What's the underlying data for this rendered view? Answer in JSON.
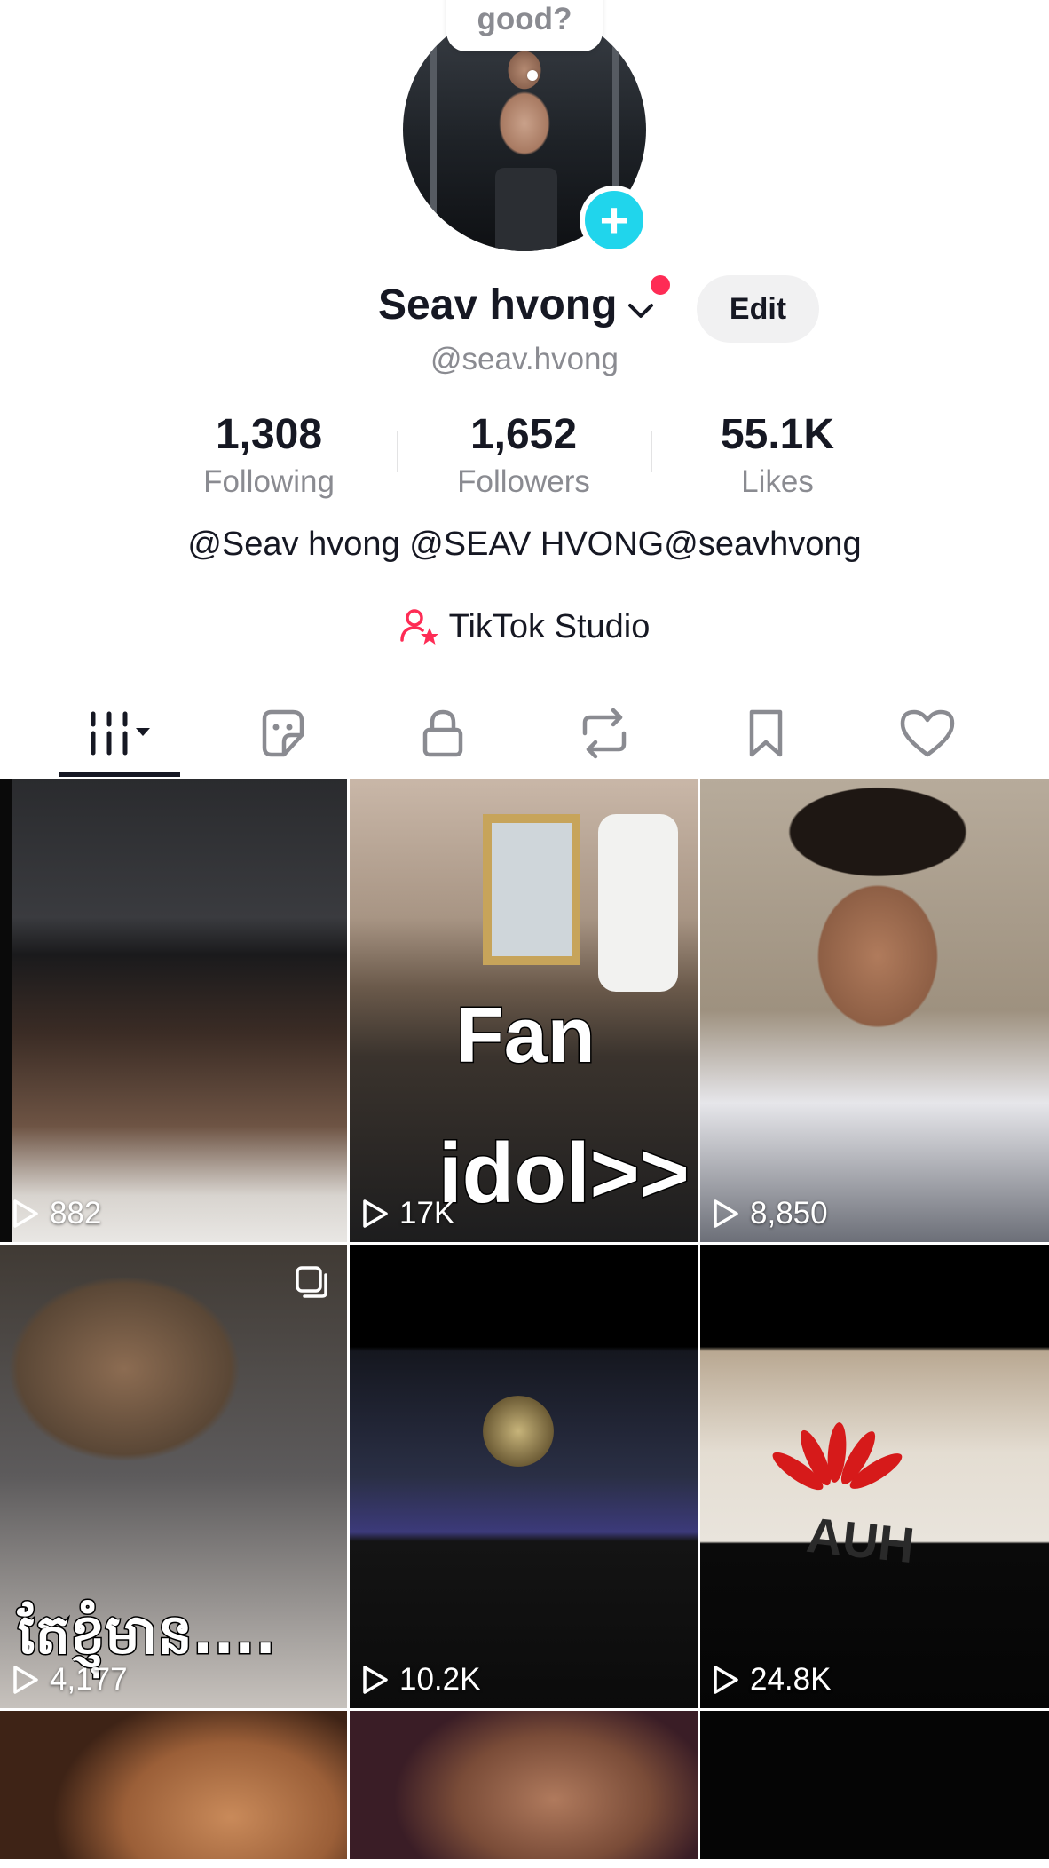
{
  "profile": {
    "speech_bubble": "good?",
    "display_name": "Seav hvong",
    "edit_label": "Edit",
    "username": "@seav.hvong",
    "bio": "@Seav hvong @SEAV HVONG@seavhvong",
    "studio_label": "TikTok Studio"
  },
  "stats": {
    "following": {
      "value": "1,308",
      "label": "Following"
    },
    "followers": {
      "value": "1,652",
      "label": "Followers"
    },
    "likes": {
      "value": "55.1K",
      "label": "Likes"
    }
  },
  "tabs": [
    "videos-tab",
    "stickers-tab",
    "private-tab",
    "reposts-tab",
    "favorites-tab",
    "liked-tab"
  ],
  "videos": [
    {
      "views": "882"
    },
    {
      "views": "17K",
      "caption_line1": "Fan",
      "caption_line2": "idol>>"
    },
    {
      "views": "8,850"
    },
    {
      "views": "4,177",
      "caption": "តែខ្ញុំមាន...."
    },
    {
      "views": "10.2K"
    },
    {
      "views": "24.8K",
      "shirt_text": "AUH"
    }
  ],
  "colors": {
    "accent_red": "#fe2c55",
    "plus_cyan": "#20d5ec",
    "text_primary": "#161823",
    "text_secondary": "#8a8b91"
  }
}
